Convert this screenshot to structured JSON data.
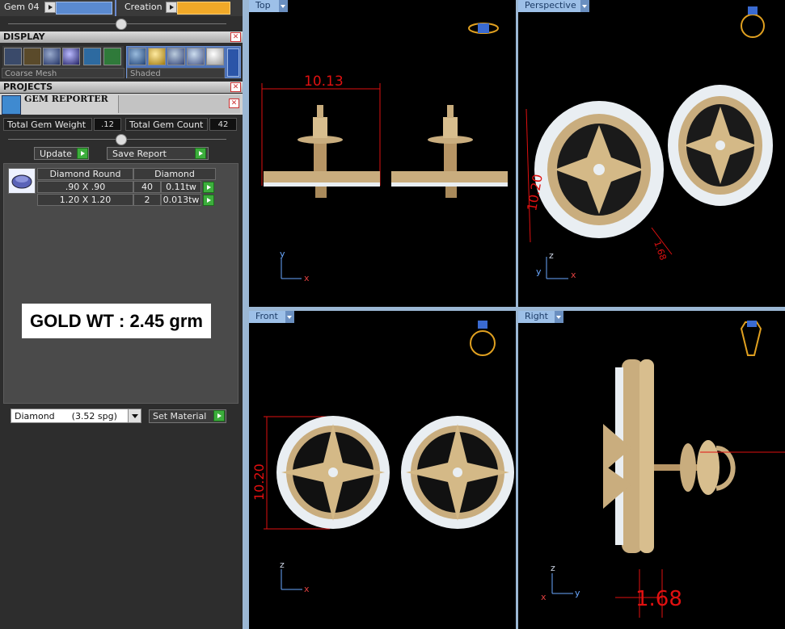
{
  "toolbar": {
    "gem_label": "Gem 04",
    "creation_label": "Creation"
  },
  "display": {
    "title": "DISPLAY",
    "mesh_option": "Coarse Mesh",
    "shade_option": "Shaded"
  },
  "projects": {
    "title": "PROJECTS"
  },
  "gem_reporter": {
    "title": "GEM REPORTER",
    "total_weight_label": "Total Gem Weight",
    "total_weight_value": ".12",
    "total_count_label": "Total Gem Count",
    "total_count_value": "42",
    "update_label": "Update",
    "save_report_label": "Save Report",
    "table": {
      "headers": [
        "Diamond Round",
        "Diamond"
      ],
      "rows": [
        {
          "size": ".90 X .90",
          "count": "40",
          "weight": "0.11tw"
        },
        {
          "size": "1.20 X 1.20",
          "count": "2",
          "weight": "0.013tw"
        }
      ]
    },
    "annotation": "GOLD WT : 2.45 grm",
    "material_value": "Diamond      (3.52 spg)",
    "set_material_label": "Set Material"
  },
  "viewports": {
    "top": {
      "label": "Top",
      "dimension": "10.13"
    },
    "perspective": {
      "label": "Perspective",
      "dimension_a": "10.20",
      "dimension_b": "1.68"
    },
    "front": {
      "label": "Front",
      "dimension": "10.20"
    },
    "right": {
      "label": "Right",
      "dimension": "1.68"
    }
  },
  "axes": {
    "x": "x",
    "y": "y",
    "z": "z"
  },
  "colors": {
    "gold": "#c9ad7e",
    "diamond": "#e9eef2",
    "dimension": "#e01010",
    "viewport_border": "#9bb7d4"
  }
}
